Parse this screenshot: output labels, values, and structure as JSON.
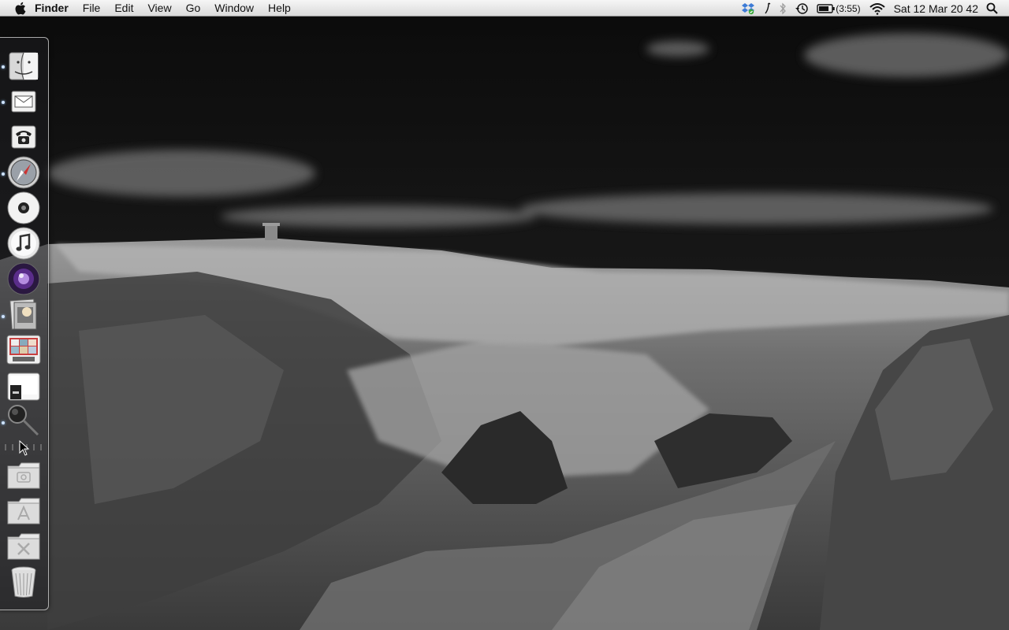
{
  "menubar": {
    "apple_icon": "apple-logo-icon",
    "app_name": "Finder",
    "menus": [
      "File",
      "Edit",
      "View",
      "Go",
      "Window",
      "Help"
    ],
    "status": {
      "battery_time": "(3:55)",
      "datetime": "Sat 12 Mar  20 42",
      "icons": [
        "dropbox-icon",
        "music-note-icon",
        "bluetooth-icon",
        "time-machine-icon",
        "battery-icon",
        "wifi-icon",
        "spotlight-search-icon"
      ]
    }
  },
  "dock": {
    "position": "left",
    "items": [
      {
        "name": "finder",
        "icon": "finder-icon",
        "running": true
      },
      {
        "name": "mail",
        "icon": "mail-icon",
        "running": true
      },
      {
        "name": "address-book",
        "icon": "telephone-icon",
        "running": false
      },
      {
        "name": "safari",
        "icon": "safari-compass-icon",
        "running": true
      },
      {
        "name": "dvd-player",
        "icon": "dvd-disc-icon",
        "running": false
      },
      {
        "name": "itunes",
        "icon": "itunes-icon",
        "running": false
      },
      {
        "name": "front-row",
        "icon": "front-row-icon",
        "running": false
      },
      {
        "name": "preview",
        "icon": "preview-icon",
        "running": true
      },
      {
        "name": "photo-booth",
        "icon": "photo-booth-icon",
        "running": false
      },
      {
        "name": "terminal",
        "icon": "terminal-icon",
        "running": false
      },
      {
        "name": "spotlight",
        "icon": "magnifier-icon",
        "running": true
      }
    ],
    "stacks": [
      {
        "name": "pictures-folder",
        "icon": "pictures-folder-icon"
      },
      {
        "name": "applications-folder",
        "icon": "applications-folder-icon"
      },
      {
        "name": "utilities-folder",
        "icon": "utilities-folder-icon"
      },
      {
        "name": "trash",
        "icon": "trash-icon"
      }
    ]
  },
  "colors": {
    "menubar_bg": "#e8e8e8",
    "dock_indicator": "#cfe3ff"
  }
}
